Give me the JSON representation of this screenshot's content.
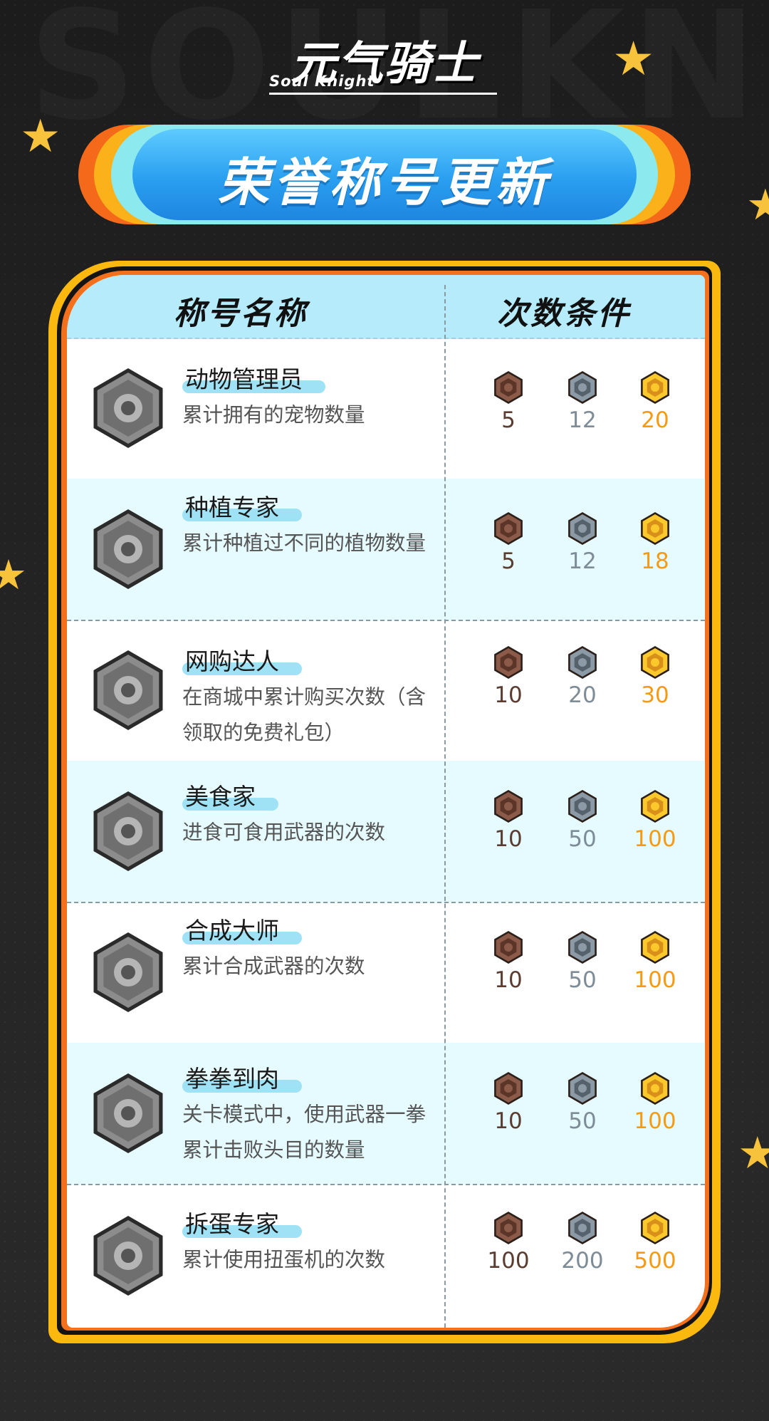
{
  "logo": {
    "title_cn": "元气骑士",
    "title_en": "Soul Knight"
  },
  "banner": {
    "title": "荣誉称号更新"
  },
  "table": {
    "header_name": "称号名称",
    "header_condition": "次数条件",
    "rows": [
      {
        "name": "动物管理员",
        "desc": "累计拥有的宠物数量",
        "icon": "pet-badge-icon",
        "bronze": "5",
        "silver": "12",
        "gold": "20"
      },
      {
        "name": "种植专家",
        "desc": "累计种植过不同的植物数量",
        "icon": "plant-badge-icon",
        "bronze": "5",
        "silver": "12",
        "gold": "18"
      },
      {
        "name": "网购达人",
        "desc": "在商城中累计购买次数（含领取的免费礼包）",
        "icon": "shopping-cart-badge-icon",
        "bronze": "10",
        "silver": "20",
        "gold": "30"
      },
      {
        "name": "美食家",
        "desc": "进食可食用武器的次数",
        "icon": "fork-knife-badge-icon",
        "bronze": "10",
        "silver": "50",
        "gold": "100"
      },
      {
        "name": "合成大师",
        "desc": "累计合成武器的次数",
        "icon": "forge-badge-icon",
        "bronze": "10",
        "silver": "50",
        "gold": "100"
      },
      {
        "name": "拳拳到肉",
        "desc": "关卡模式中，使用武器一拳累计击败头目的数量",
        "icon": "fist-badge-icon",
        "bronze": "10",
        "silver": "50",
        "gold": "100"
      },
      {
        "name": "拆蛋专家",
        "desc": "累计使用扭蛋机的次数",
        "icon": "gacha-badge-icon",
        "bronze": "100",
        "silver": "200",
        "gold": "500"
      }
    ]
  },
  "colors": {
    "bronze": "#7a4a3a",
    "silver": "#7d8c97",
    "gold": "#f7b718",
    "banner_blue": "#2a9ff0",
    "frame_yellow": "#fbb80f",
    "header_bg": "#b5ebfb"
  }
}
